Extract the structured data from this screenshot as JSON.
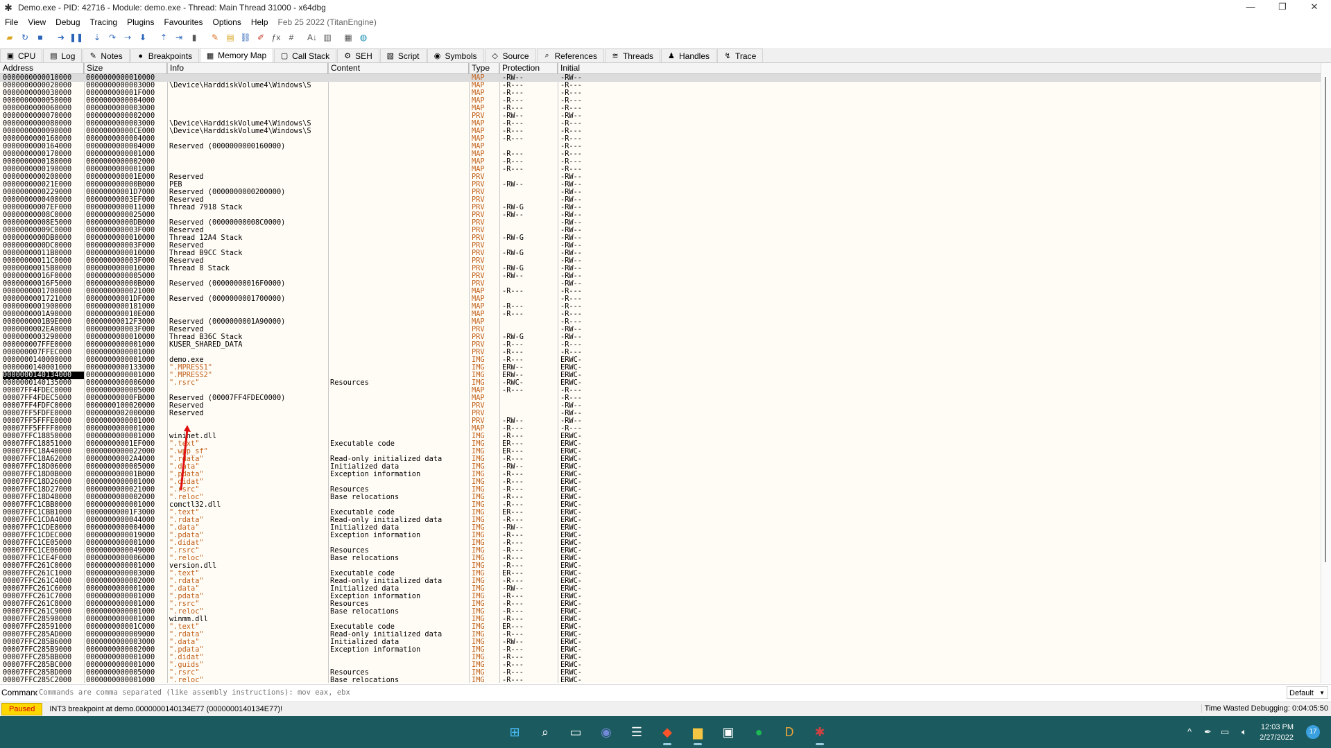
{
  "window": {
    "title": "Demo.exe - PID: 42716 - Module: demo.exe - Thread: Main Thread 31000 - x64dbg",
    "app_icon": "bug-icon",
    "controls": [
      "—",
      "❐",
      "✕"
    ]
  },
  "menu": {
    "items": [
      "File",
      "View",
      "Debug",
      "Tracing",
      "Plugins",
      "Favourites",
      "Options",
      "Help"
    ],
    "build_date": "Feb 25 2022 (TitanEngine)"
  },
  "toolbar": {
    "buttons": [
      "open-icon",
      "restart-icon",
      "stop-icon",
      "run-icon",
      "pause-icon",
      "step-into-icon",
      "step-over-icon",
      "trace-into-icon",
      "trace-over-icon",
      "execute-till-return-icon",
      "run-to-user-code-icon",
      "scylla-icon",
      "patch-icon",
      "comment-icon",
      "label-icon",
      "bookmark-icon",
      "function-icon",
      "hash-icon",
      "font-icon",
      "memory-icon",
      "calculator-icon",
      "globe-icon"
    ]
  },
  "tabs": [
    {
      "label": "CPU",
      "icon": "cpu-icon",
      "glyph": "▣"
    },
    {
      "label": "Log",
      "icon": "log-icon",
      "glyph": "▤"
    },
    {
      "label": "Notes",
      "icon": "notes-icon",
      "glyph": "✎"
    },
    {
      "label": "Breakpoints",
      "icon": "breakpoint-icon",
      "glyph": "●"
    },
    {
      "label": "Memory Map",
      "icon": "memory-map-icon",
      "glyph": "▦",
      "active": true
    },
    {
      "label": "Call Stack",
      "icon": "call-stack-icon",
      "glyph": "▢"
    },
    {
      "label": "SEH",
      "icon": "seh-icon",
      "glyph": "⚙"
    },
    {
      "label": "Script",
      "icon": "script-icon",
      "glyph": "▧"
    },
    {
      "label": "Symbols",
      "icon": "symbols-icon",
      "glyph": "◉"
    },
    {
      "label": "Source",
      "icon": "source-icon",
      "glyph": "◇"
    },
    {
      "label": "References",
      "icon": "references-icon",
      "glyph": "⌕"
    },
    {
      "label": "Threads",
      "icon": "threads-icon",
      "glyph": "≋"
    },
    {
      "label": "Handles",
      "icon": "handles-icon",
      "glyph": "♟"
    },
    {
      "label": "Trace",
      "icon": "trace-icon",
      "glyph": "↯"
    }
  ],
  "columns": [
    "Address",
    "Size",
    "Info",
    "Content",
    "Type",
    "Protection",
    "Initial"
  ],
  "rows": [
    [
      "0000000000010000",
      "0000000000010000",
      "",
      "",
      "MAP",
      "-RW--",
      "-RW--"
    ],
    [
      "0000000000020000",
      "0000000000003000",
      "\\Device\\HarddiskVolume4\\Windows\\S",
      "",
      "MAP",
      "-R---",
      "-R---"
    ],
    [
      "0000000000030000",
      "000000000001F000",
      "",
      "",
      "MAP",
      "-R---",
      "-R---"
    ],
    [
      "0000000000050000",
      "0000000000004000",
      "",
      "",
      "MAP",
      "-R---",
      "-R---"
    ],
    [
      "0000000000060000",
      "0000000000003000",
      "",
      "",
      "MAP",
      "-R---",
      "-R---"
    ],
    [
      "0000000000070000",
      "0000000000002000",
      "",
      "",
      "PRV",
      "-RW--",
      "-RW--"
    ],
    [
      "0000000000080000",
      "0000000000003000",
      "\\Device\\HarddiskVolume4\\Windows\\S",
      "",
      "MAP",
      "-R---",
      "-R---"
    ],
    [
      "0000000000090000",
      "00000000000CE000",
      "\\Device\\HarddiskVolume4\\Windows\\S",
      "",
      "MAP",
      "-R---",
      "-R---"
    ],
    [
      "0000000000160000",
      "0000000000004000",
      "",
      "",
      "MAP",
      "-R---",
      "-R---"
    ],
    [
      "0000000000164000",
      "0000000000004000",
      "Reserved (0000000000160000)",
      "",
      "MAP",
      "",
      "-R---"
    ],
    [
      "0000000000170000",
      "0000000000001000",
      "",
      "",
      "MAP",
      "-R---",
      "-R---"
    ],
    [
      "0000000000180000",
      "0000000000002000",
      "",
      "",
      "MAP",
      "-R---",
      "-R---"
    ],
    [
      "0000000000190000",
      "0000000000001000",
      "",
      "",
      "MAP",
      "-R---",
      "-R---"
    ],
    [
      "0000000000200000",
      "000000000001E000",
      "Reserved",
      "",
      "PRV",
      "",
      "-RW--"
    ],
    [
      "000000000021E000",
      "000000000000B000",
      "PEB",
      "",
      "PRV",
      "-RW--",
      "-RW--"
    ],
    [
      "0000000000229000",
      "00000000001D7000",
      "Reserved (0000000000200000)",
      "",
      "PRV",
      "",
      "-RW--"
    ],
    [
      "0000000000400000",
      "00000000003EF000",
      "Reserved",
      "",
      "PRV",
      "",
      "-RW--"
    ],
    [
      "00000000007EF000",
      "0000000000011000",
      "Thread 7918 Stack",
      "",
      "PRV",
      "-RW-G",
      "-RW--"
    ],
    [
      "00000000008C0000",
      "0000000000025000",
      "",
      "",
      "PRV",
      "-RW--",
      "-RW--"
    ],
    [
      "00000000008E5000",
      "00000000000DB000",
      "Reserved (00000000008C0000)",
      "",
      "PRV",
      "",
      "-RW--"
    ],
    [
      "00000000009C0000",
      "000000000003F000",
      "Reserved",
      "",
      "PRV",
      "",
      "-RW--"
    ],
    [
      "0000000000DB0000",
      "0000000000010000",
      "Thread 12A4 Stack",
      "",
      "PRV",
      "-RW-G",
      "-RW--"
    ],
    [
      "0000000000DC0000",
      "000000000003F000",
      "Reserved",
      "",
      "PRV",
      "",
      "-RW--"
    ],
    [
      "00000000011B0000",
      "0000000000010000",
      "Thread B9CC Stack",
      "",
      "PRV",
      "-RW-G",
      "-RW--"
    ],
    [
      "00000000011C0000",
      "000000000003F000",
      "Reserved",
      "",
      "PRV",
      "",
      "-RW--"
    ],
    [
      "00000000015B0000",
      "0000000000010000",
      "Thread 8 Stack",
      "",
      "PRV",
      "-RW-G",
      "-RW--"
    ],
    [
      "00000000016F0000",
      "0000000000005000",
      "",
      "",
      "PRV",
      "-RW--",
      "-RW--"
    ],
    [
      "00000000016F5000",
      "000000000000B000",
      "Reserved (00000000016F0000)",
      "",
      "PRV",
      "",
      "-RW--"
    ],
    [
      "0000000001700000",
      "0000000000021000",
      "",
      "",
      "MAP",
      "-R---",
      "-R---"
    ],
    [
      "0000000001721000",
      "00000000001DF000",
      "Reserved (0000000001700000)",
      "",
      "MAP",
      "",
      "-R---"
    ],
    [
      "0000000001900000",
      "0000000000181000",
      "",
      "",
      "MAP",
      "-R---",
      "-R---"
    ],
    [
      "0000000001A90000",
      "000000000010E000",
      "",
      "",
      "MAP",
      "-R---",
      "-R---"
    ],
    [
      "0000000001B9E000",
      "00000000012F3000",
      "Reserved (0000000001A90000)",
      "",
      "MAP",
      "",
      "-R---"
    ],
    [
      "0000000002EA0000",
      "000000000003F000",
      "Reserved",
      "",
      "PRV",
      "",
      "-RW--"
    ],
    [
      "0000000003290000",
      "0000000000010000",
      "Thread B36C Stack",
      "",
      "PRV",
      "-RW-G",
      "-RW--"
    ],
    [
      "000000007FFE0000",
      "0000000000001000",
      "KUSER_SHARED_DATA",
      "",
      "PRV",
      "-R---",
      "-R---"
    ],
    [
      "000000007FFEC000",
      "0000000000001000",
      "",
      "",
      "PRV",
      "-R---",
      "-R---"
    ],
    [
      "0000000140000000",
      "0000000000001000",
      "demo.exe",
      "",
      "IMG",
      "-R---",
      "ERWC-"
    ],
    [
      "0000000140001000",
      "0000000000133000",
      "\".MPRESS1\"",
      "",
      "IMG",
      "ERW--",
      "ERWC-"
    ],
    [
      "0000000140134000",
      "0000000000001000",
      "\".MPRESS2\"",
      "",
      "IMG",
      "ERW--",
      "ERWC-"
    ],
    [
      "0000000140135000",
      "0000000000006000",
      "\".rsrc\"",
      "Resources",
      "IMG",
      "-RWC-",
      "ERWC-"
    ],
    [
      "00007FF4FDEC0000",
      "0000000000005000",
      "",
      "",
      "MAP",
      "-R---",
      "-R---"
    ],
    [
      "00007FF4FDEC5000",
      "00000000000FB000",
      "Reserved (00007FF4FDEC0000)",
      "",
      "MAP",
      "",
      "-R---"
    ],
    [
      "00007FF4FDFC0000",
      "0000000100020000",
      "Reserved",
      "",
      "PRV",
      "",
      "-RW--"
    ],
    [
      "00007FF5FDFE0000",
      "0000000002000000",
      "Reserved",
      "",
      "PRV",
      "",
      "-RW--"
    ],
    [
      "00007FF5FFFE0000",
      "0000000000001000",
      "",
      "",
      "PRV",
      "-RW--",
      "-RW--"
    ],
    [
      "00007FF5FFFF0000",
      "0000000000001000",
      "",
      "",
      "MAP",
      "-R---",
      "-R---"
    ],
    [
      "00007FFC18850000",
      "0000000000001000",
      "wininet.dll",
      "",
      "IMG",
      "-R---",
      "ERWC-"
    ],
    [
      "00007FFC18851000",
      "00000000001EF000",
      "\".text\"",
      "Executable code",
      "IMG",
      "ER---",
      "ERWC-"
    ],
    [
      "00007FFC18A40000",
      "0000000000022000",
      "\".wpp_sf\"",
      "",
      "IMG",
      "ER---",
      "ERWC-"
    ],
    [
      "00007FFC18A62000",
      "00000000002A4000",
      "\".rdata\"",
      "Read-only initialized data",
      "IMG",
      "-R---",
      "ERWC-"
    ],
    [
      "00007FFC18D06000",
      "0000000000005000",
      "\".data\"",
      "Initialized data",
      "IMG",
      "-RW--",
      "ERWC-"
    ],
    [
      "00007FFC18D0B000",
      "000000000001B000",
      "\".pdata\"",
      "Exception information",
      "IMG",
      "-R---",
      "ERWC-"
    ],
    [
      "00007FFC18D26000",
      "0000000000001000",
      "\".didat\"",
      "",
      "IMG",
      "-R---",
      "ERWC-"
    ],
    [
      "00007FFC18D27000",
      "0000000000021000",
      "\".rsrc\"",
      "Resources",
      "IMG",
      "-R---",
      "ERWC-"
    ],
    [
      "00007FFC18D48000",
      "0000000000002000",
      "\".reloc\"",
      "Base relocations",
      "IMG",
      "-R---",
      "ERWC-"
    ],
    [
      "00007FFC1CBB0000",
      "0000000000001000",
      "comctl32.dll",
      "",
      "IMG",
      "-R---",
      "ERWC-"
    ],
    [
      "00007FFC1CBB1000",
      "00000000001F3000",
      "\".text\"",
      "Executable code",
      "IMG",
      "ER---",
      "ERWC-"
    ],
    [
      "00007FFC1CDA4000",
      "0000000000044000",
      "\".rdata\"",
      "Read-only initialized data",
      "IMG",
      "-R---",
      "ERWC-"
    ],
    [
      "00007FFC1CDE8000",
      "0000000000004000",
      "\".data\"",
      "Initialized data",
      "IMG",
      "-RW--",
      "ERWC-"
    ],
    [
      "00007FFC1CDEC000",
      "0000000000019000",
      "\".pdata\"",
      "Exception information",
      "IMG",
      "-R---",
      "ERWC-"
    ],
    [
      "00007FFC1CE05000",
      "0000000000001000",
      "\".didat\"",
      "",
      "IMG",
      "-R---",
      "ERWC-"
    ],
    [
      "00007FFC1CE06000",
      "0000000000049000",
      "\".rsrc\"",
      "Resources",
      "IMG",
      "-R---",
      "ERWC-"
    ],
    [
      "00007FFC1CE4F000",
      "0000000000006000",
      "\".reloc\"",
      "Base relocations",
      "IMG",
      "-R---",
      "ERWC-"
    ],
    [
      "00007FFC261C0000",
      "0000000000001000",
      "version.dll",
      "",
      "IMG",
      "-R---",
      "ERWC-"
    ],
    [
      "00007FFC261C1000",
      "0000000000003000",
      "\".text\"",
      "Executable code",
      "IMG",
      "ER---",
      "ERWC-"
    ],
    [
      "00007FFC261C4000",
      "0000000000002000",
      "\".rdata\"",
      "Read-only initialized data",
      "IMG",
      "-R---",
      "ERWC-"
    ],
    [
      "00007FFC261C6000",
      "0000000000001000",
      "\".data\"",
      "Initialized data",
      "IMG",
      "-RW--",
      "ERWC-"
    ],
    [
      "00007FFC261C7000",
      "0000000000001000",
      "\".pdata\"",
      "Exception information",
      "IMG",
      "-R---",
      "ERWC-"
    ],
    [
      "00007FFC261C8000",
      "0000000000001000",
      "\".rsrc\"",
      "Resources",
      "IMG",
      "-R---",
      "ERWC-"
    ],
    [
      "00007FFC261C9000",
      "0000000000001000",
      "\".reloc\"",
      "Base relocations",
      "IMG",
      "-R---",
      "ERWC-"
    ],
    [
      "00007FFC28590000",
      "0000000000001000",
      "winmm.dll",
      "",
      "IMG",
      "-R---",
      "ERWC-"
    ],
    [
      "00007FFC28591000",
      "000000000001C000",
      "\".text\"",
      "Executable code",
      "IMG",
      "ER---",
      "ERWC-"
    ],
    [
      "00007FFC285AD000",
      "0000000000009000",
      "\".rdata\"",
      "Read-only initialized data",
      "IMG",
      "-R---",
      "ERWC-"
    ],
    [
      "00007FFC285B6000",
      "0000000000003000",
      "\".data\"",
      "Initialized data",
      "IMG",
      "-RW--",
      "ERWC-"
    ],
    [
      "00007FFC285B9000",
      "0000000000002000",
      "\".pdata\"",
      "Exception information",
      "IMG",
      "-R---",
      "ERWC-"
    ],
    [
      "00007FFC285BB000",
      "0000000000001000",
      "\".didat\"",
      "",
      "IMG",
      "-R---",
      "ERWC-"
    ],
    [
      "00007FFC285BC000",
      "0000000000001000",
      "\".guids\"",
      "",
      "IMG",
      "-R---",
      "ERWC-"
    ],
    [
      "00007FFC285BD000",
      "0000000000005000",
      "\".rsrc\"",
      "Resources",
      "IMG",
      "-R---",
      "ERWC-"
    ],
    [
      "00007FFC285C2000",
      "0000000000001000",
      "\".reloc\"",
      "Base relocations",
      "IMG",
      "-R---",
      "ERWC-"
    ]
  ],
  "selected_row_index": 39,
  "command": {
    "label": "Command:",
    "placeholder": "Commands are comma separated (like assembly instructions): mov eax, ebx",
    "dropdown_value": "Default"
  },
  "status": {
    "state": "Paused",
    "message": "INT3 breakpoint at demo.0000000140134E77 (0000000140134E77)!",
    "time_wasted": "Time Wasted Debugging: 0:04:05:50"
  },
  "taskbar": {
    "apps": [
      {
        "name": "windows-start-icon",
        "glyph": "⊞",
        "color": "#4cc2ff"
      },
      {
        "name": "search-icon",
        "glyph": "⌕",
        "color": "#ffffff"
      },
      {
        "name": "task-view-icon",
        "glyph": "▭",
        "color": "#ffffff"
      },
      {
        "name": "discord-icon",
        "glyph": "◉",
        "color": "#7289da"
      },
      {
        "name": "menu-app-icon",
        "glyph": "☰",
        "color": "#ffffff"
      },
      {
        "name": "brave-browser-icon",
        "glyph": "◆",
        "color": "#fb542b"
      },
      {
        "name": "file-explorer-icon",
        "glyph": "▆",
        "color": "#f4c542"
      },
      {
        "name": "store-icon",
        "glyph": "▣",
        "color": "#ffffff"
      },
      {
        "name": "spotify-icon",
        "glyph": "●",
        "color": "#1db954"
      },
      {
        "name": "davinci-icon",
        "glyph": "D",
        "color": "#e8a33a"
      },
      {
        "name": "x64dbg-icon",
        "glyph": "✱",
        "color": "#d04040"
      }
    ],
    "clock_time": "12:03 PM",
    "clock_date": "2/27/2022",
    "notification_count": "17"
  }
}
